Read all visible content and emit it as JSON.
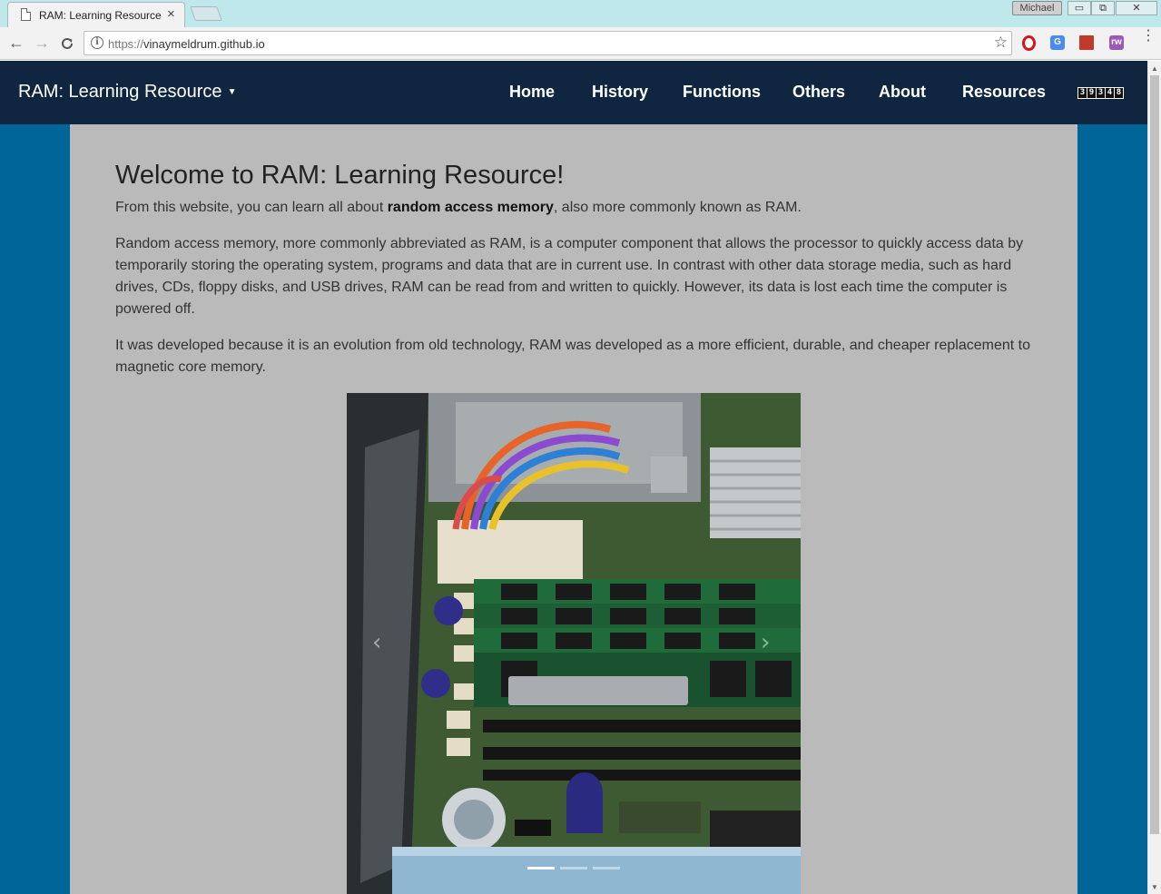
{
  "browser": {
    "tab_title": "RAM: Learning Resource",
    "tab_close": "×",
    "profile": "Michael",
    "win_min": "▭",
    "win_restore": "⧉",
    "win_close": "✕",
    "back": "←",
    "forward": "→",
    "reload": "C",
    "info": "i",
    "url_scheme": "https://",
    "url_host": "vinaymeldrum.github.io",
    "star": "☆",
    "menu": "⋮"
  },
  "site": {
    "brand": "RAM: Learning Resource",
    "brand_caret": "▼",
    "nav": [
      "Home",
      "History",
      "Functions",
      "Others",
      "About",
      "Resources"
    ],
    "counter": [
      "3",
      "9",
      "3",
      "4",
      "8"
    ]
  },
  "main": {
    "heading": "Welcome to RAM: Learning Resource!",
    "intro_before": "From this website, you can learn all about ",
    "intro_bold": "random access memory",
    "intro_after": ", also more commonly known as RAM.",
    "para2": "Random access memory, more commonly abbreviated as RAM, is a computer component that allows the processor to quickly access data by temporarily storing the operating system, programs and data that are in current use. In contrast with other data storage media, such as hard drives, CDs, floppy disks, and USB drives, RAM can be read from and written to quickly. However, its data is lost each time the computer is powered off.",
    "para3": "It was developed because it is an evolution from old technology, RAM was developed as a more efficient, durable, and cheaper replacement to magnetic core memory.",
    "carousel": {
      "prev": "‹",
      "next": "›",
      "slide_count": 3,
      "active_slide": 1
    }
  },
  "colors": {
    "page_bg": "#006699",
    "navbar_bg": "#102640",
    "content_bg": "#bababa",
    "tabstrip": "#bfe8ec"
  }
}
